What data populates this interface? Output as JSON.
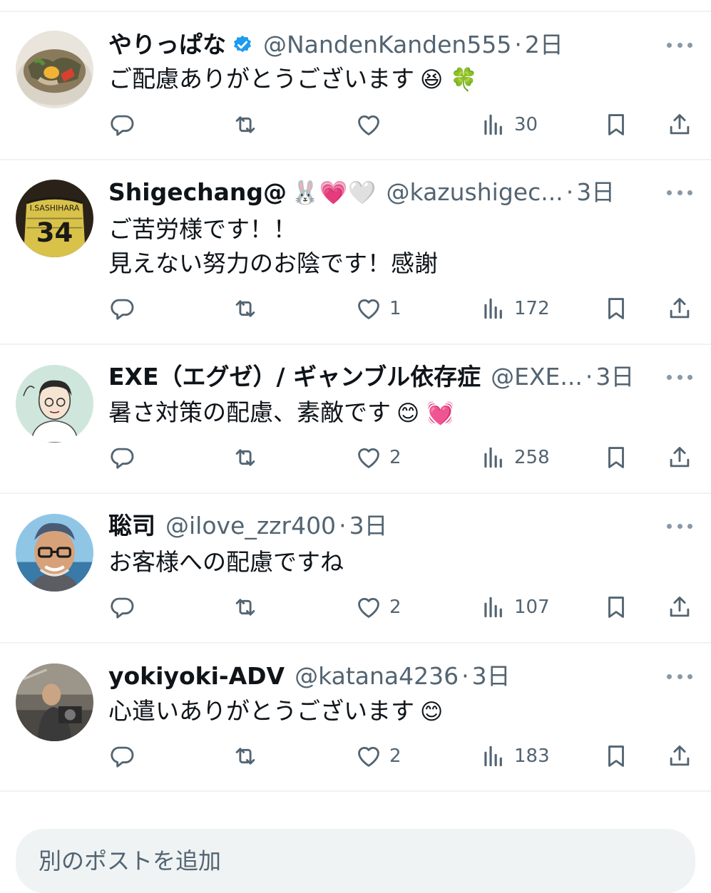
{
  "colors": {
    "text": "#0f1419",
    "muted": "#536471",
    "divider": "#eff3f4",
    "verified": "#1d9bf0"
  },
  "replies": [
    {
      "name": "やりっぱな",
      "verified": true,
      "name_emoji": "",
      "handle": "@NandenKanden555",
      "time": "2日",
      "text_lines": [
        "ご配慮ありがとうございます"
      ],
      "text_emoji": "😆 🍀",
      "stats": {
        "replies": "",
        "reposts": "",
        "likes": "",
        "views": "30"
      },
      "avatar_icon": "food-bowl-avatar"
    },
    {
      "name": "Shigechang@",
      "verified": false,
      "name_emoji": "🐰💗🤍",
      "handle": "@kazushigec...",
      "time": "3日",
      "text_lines": [
        "ご苦労様です！！",
        "見えない努力のお陰です！感謝"
      ],
      "text_emoji": "",
      "stats": {
        "replies": "",
        "reposts": "",
        "likes": "1",
        "views": "172"
      },
      "avatar_icon": "jersey-avatar"
    },
    {
      "name": "EXE（エグゼ）/ ギャンブル依存症",
      "verified": false,
      "name_emoji": "",
      "handle": "@EXE...",
      "time": "3日",
      "text_lines": [
        "暑さ対策の配慮、素敵です"
      ],
      "text_emoji": "😊 💓",
      "stats": {
        "replies": "",
        "reposts": "",
        "likes": "2",
        "views": "258"
      },
      "avatar_icon": "illustrated-man-avatar"
    },
    {
      "name": "聡司",
      "verified": false,
      "name_emoji": "",
      "handle": "@ilove_zzr400",
      "time": "3日",
      "text_lines": [
        "お客様への配慮ですね"
      ],
      "text_emoji": "",
      "stats": {
        "replies": "",
        "reposts": "",
        "likes": "2",
        "views": "107"
      },
      "avatar_icon": "cartoon-glasses-avatar"
    },
    {
      "name": "yokiyoki-ADV",
      "verified": false,
      "name_emoji": "",
      "handle": "@katana4236",
      "time": "3日",
      "text_lines": [
        "心遣いありがとうございます"
      ],
      "text_emoji": "😊",
      "stats": {
        "replies": "",
        "reposts": "",
        "likes": "2",
        "views": "183"
      },
      "avatar_icon": "photo-avatar"
    }
  ],
  "separator": "·",
  "composer": {
    "placeholder": "別のポストを追加"
  }
}
